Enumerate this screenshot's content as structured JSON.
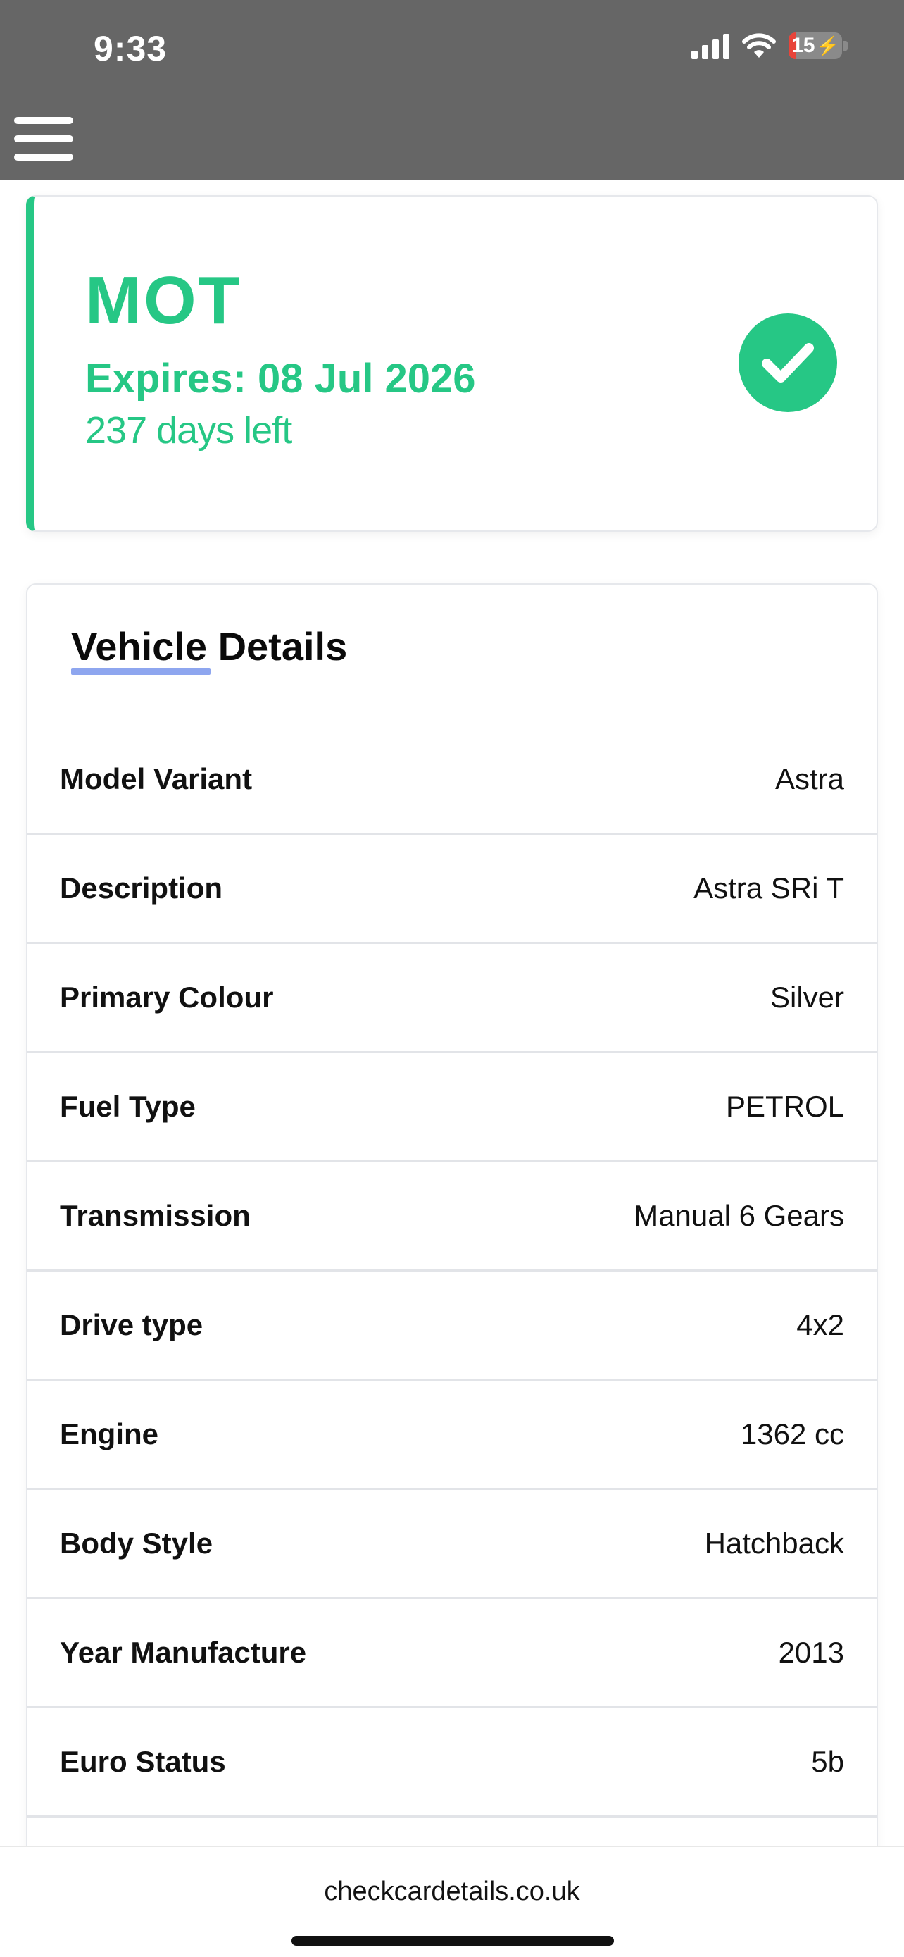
{
  "status_bar": {
    "time": "9:33",
    "battery_level": "15",
    "battery_percent": 15,
    "icons": [
      "cellular-signal-icon",
      "wifi-icon",
      "battery-charging-icon"
    ]
  },
  "header": {
    "menu_icon": "hamburger-menu-icon"
  },
  "mot": {
    "title": "MOT",
    "expires": "Expires: 08 Jul 2026",
    "days_left": "237 days left",
    "status_icon": "check-circle-icon",
    "accent_color": "#26c785"
  },
  "vehicle_details": {
    "title": "Vehicle Details",
    "underline_color": "#8ea6ef",
    "rows": [
      {
        "label": "Model Variant",
        "value": "Astra"
      },
      {
        "label": "Description",
        "value": "Astra SRi T"
      },
      {
        "label": "Primary Colour",
        "value": "Silver"
      },
      {
        "label": "Fuel Type",
        "value": "PETROL"
      },
      {
        "label": "Transmission",
        "value": "Manual 6 Gears"
      },
      {
        "label": "Drive type",
        "value": "4x2"
      },
      {
        "label": "Engine",
        "value": "1362 cc"
      },
      {
        "label": "Body Style",
        "value": "Hatchback"
      },
      {
        "label": "Year Manufacture",
        "value": "2013"
      },
      {
        "label": "Euro Status",
        "value": "5b"
      }
    ]
  },
  "browser": {
    "url": "checkcardetails.co.uk"
  }
}
